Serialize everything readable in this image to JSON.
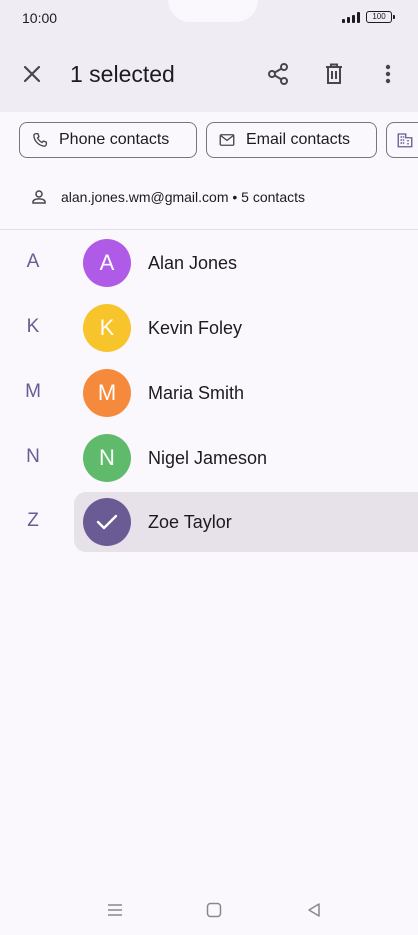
{
  "status": {
    "time": "10:00",
    "battery": "100"
  },
  "appbar": {
    "title": "1 selected"
  },
  "chips": [
    {
      "label": "Phone contacts"
    },
    {
      "label": "Email contacts"
    },
    {
      "label": ""
    }
  ],
  "account": {
    "text": "alan.jones.wm@gmail.com • 5 contacts"
  },
  "contacts": [
    {
      "letter": "A",
      "initial": "A",
      "name": "Alan Jones",
      "color": "#b05ae8",
      "selected": false
    },
    {
      "letter": "K",
      "initial": "K",
      "name": "Kevin Foley",
      "color": "#f8c42b",
      "selected": false
    },
    {
      "letter": "M",
      "initial": "M",
      "name": "Maria Smith",
      "color": "#f58a3c",
      "selected": false
    },
    {
      "letter": "N",
      "initial": "N",
      "name": "Nigel Jameson",
      "color": "#5fba6c",
      "selected": false
    },
    {
      "letter": "Z",
      "initial": "",
      "name": "Zoe Taylor",
      "color": "#6b5b95",
      "selected": true
    }
  ],
  "colors": {
    "accent": "#6b5b95",
    "appbar_bg": "#efecf4",
    "selected_bg": "#e7e1ea"
  }
}
